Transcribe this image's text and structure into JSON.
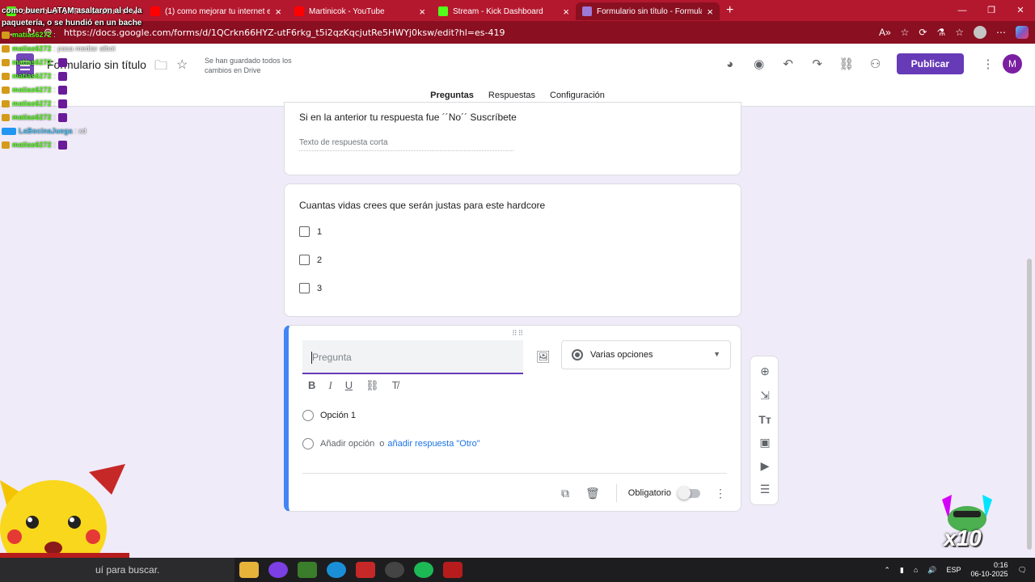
{
  "browser": {
    "tabs": [
      {
        "label": "como buen LATAM asaltaron al de la paquetería",
        "color": "#53fc18"
      },
      {
        "label": "(1) como mejorar tu internet en p",
        "color": "#ff0000"
      },
      {
        "label": "Martinicok - YouTube",
        "color": "#ff0000"
      },
      {
        "label": "Stream - Kick Dashboard",
        "color": "#53fc18"
      },
      {
        "label": "Formulario sin título - Formulario",
        "color": "#7248b9"
      }
    ],
    "url": "https://docs.google.com/forms/d/1QCrkn66HYZ-utF6rkg_t5i2qzKqcjutRe5HWYj0ksw/edit?hl=es-419"
  },
  "header": {
    "form_title": "Formulario sin título",
    "saved_status": "Se han guardado todos los cambios en Drive",
    "publish_label": "Publicar",
    "avatar_letter": "M",
    "tabs": [
      "Preguntas",
      "Respuestas",
      "Configuración"
    ]
  },
  "questions": {
    "q1_title": "Si en la anterior tu respuesta fue ´´No´´ Suscríbete",
    "q1_placeholder": "Texto de respuesta corta",
    "q2_title": "Cuantas vidas crees que serán justas para este hardcore",
    "q2_options": [
      "1",
      "2",
      "3"
    ]
  },
  "editor": {
    "question_placeholder": "Pregunta",
    "type_label": "Varias opciones",
    "option1": "Opción 1",
    "add_option": "Añadir opción",
    "or_text": "o",
    "add_other": "añadir respuesta \"Otro\"",
    "required_label": "Obligatorio"
  },
  "overlay": {
    "title": "como buen LATAM asaltaron al de la paquetería, o se hundió en un bache",
    "chat": [
      {
        "user": "matias6272",
        "msg": ":"
      },
      {
        "user": "matias6272",
        "msg": ": pasa mediar albot"
      },
      {
        "user": "matias6272",
        "msg": ":"
      },
      {
        "user": "matias6272",
        "msg": ":"
      },
      {
        "user": "matias6272",
        "msg": ":"
      },
      {
        "user": "matias6272",
        "msg": ":"
      },
      {
        "user": "matias6272",
        "msg": ":"
      },
      {
        "user": "LaBocinaJuega",
        "msg": ": xd"
      },
      {
        "user": "matias6272",
        "msg": ":"
      }
    ],
    "multiplier": "x10"
  },
  "taskbar": {
    "search_text": "uí para buscar.",
    "lang": "ESP",
    "time": "0:16",
    "date": "06-10-2025"
  }
}
